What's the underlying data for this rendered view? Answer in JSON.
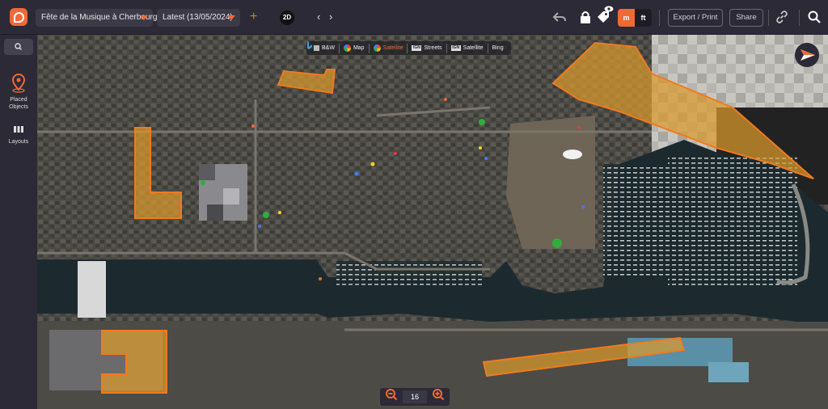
{
  "app": {
    "logo": "planning-app-logo"
  },
  "topbar": {
    "event_dropdown": "Fête de la Musique à Cherbourg",
    "version_dropdown": "Latest (13/05/2024)",
    "add_symbol": "+",
    "view_mode": "2D",
    "prev_arrow": "‹",
    "next_arrow": "›",
    "unit_metric": "m",
    "unit_imperial": "ft",
    "export_label": "Export / Print",
    "share_label": "Share",
    "icons": [
      "undo-icon",
      "lock-icon",
      "tags-icon",
      "eye-icon",
      "link-icon",
      "search-icon"
    ]
  },
  "sidebar": {
    "items": [
      {
        "label_line1": "Placed",
        "label_line2": "Objects",
        "icon": "map-pin-icon"
      },
      {
        "label_line1": "Layouts",
        "icon": "layouts-icon"
      }
    ]
  },
  "map": {
    "layers": [
      {
        "label": "B&W",
        "icon": "bw-map-icon"
      },
      {
        "label": "Map",
        "icon": "google-icon"
      },
      {
        "label": "Satellite",
        "icon": "google-icon"
      },
      {
        "label": "Streets",
        "icon": "ign-icon",
        "badge": "IGN"
      },
      {
        "label": "Satellite",
        "icon": "ign-icon",
        "badge": "IGN"
      },
      {
        "label": "Bing",
        "icon": "bing-icon"
      }
    ],
    "zoom_level": "16",
    "colors": {
      "zone_fill": "#d99a2b",
      "zone_stroke": "#f07a1e",
      "accent": "#f06a35",
      "water": "#1c2a2f"
    }
  }
}
